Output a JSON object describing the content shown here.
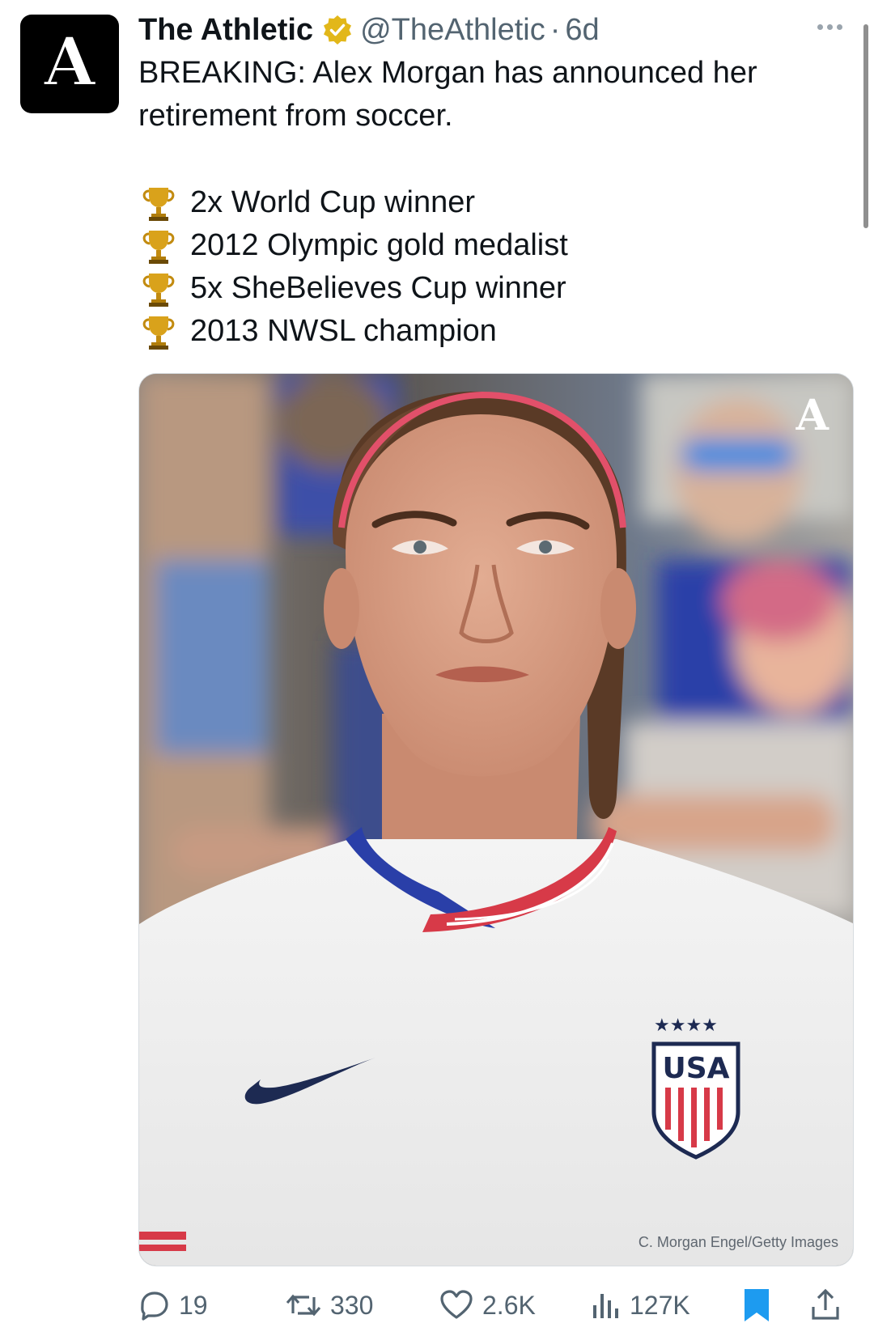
{
  "tweet": {
    "author_name": "The Athletic",
    "avatar_letter": "A",
    "handle": "@TheAthletic",
    "separator": "·",
    "time": "6d",
    "text_line1": "BREAKING: Alex Morgan has announced her",
    "text_line2": "retirement from soccer.",
    "achievements": [
      {
        "icon": "trophy-icon",
        "text": "2x World Cup winner"
      },
      {
        "icon": "trophy-icon",
        "text": "2012 Olympic gold medalist"
      },
      {
        "icon": "trophy-icon",
        "text": "5x SheBelieves Cup winner"
      },
      {
        "icon": "trophy-icon",
        "text": "2013 NWSL champion"
      }
    ],
    "photo": {
      "logo_letter": "A",
      "credit": "C. Morgan Engel/Getty Images",
      "badge_text": "USA"
    }
  },
  "actions": {
    "replies": "19",
    "reposts": "330",
    "likes": "2.6K",
    "views": "127K"
  },
  "colors": {
    "text": "#0f1419",
    "secondary": "#536471",
    "bookmark": "#1d9bf0",
    "verified": "#e2b719"
  }
}
